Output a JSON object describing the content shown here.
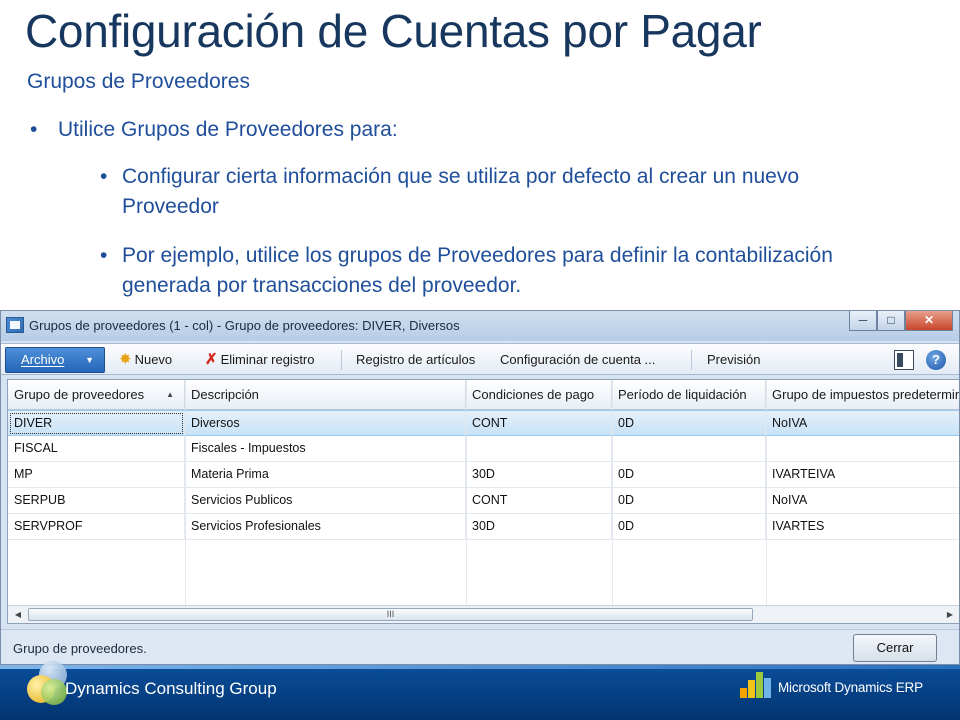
{
  "slide": {
    "title": "Configuración de Cuentas por Pagar",
    "subtitle": "Grupos de Proveedores",
    "bullet_main": "Utilice Grupos de Proveedores para:",
    "bullet_sub_1": "Configurar cierta información que se utiliza por defecto al crear un nuevo Proveedor",
    "bullet_sub_2": "Por ejemplo, utilice los grupos de Proveedores para definir la contabilización generada por transacciones del proveedor.",
    "bullet_glyph": "•"
  },
  "window": {
    "title": "Grupos de proveedores (1 - col) - Grupo de proveedores: DIVER, Diversos",
    "minimize": "─",
    "maximize": "□",
    "close": "✕"
  },
  "toolbar": {
    "archivo": "Archivo",
    "nuevo": "Nuevo",
    "eliminar": "Eliminar registro",
    "registro_articulos": "Registro de artículos",
    "configuracion_cuenta": "Configuración de cuenta ...",
    "prevision": "Previsión",
    "help": "?"
  },
  "grid": {
    "columns": [
      "Grupo de proveedores",
      "Descripción",
      "Condiciones de pago",
      "Período de liquidación",
      "Grupo de impuestos predeterminado"
    ],
    "rows": [
      [
        "DIVER",
        "Diversos",
        "CONT",
        "0D",
        "NoIVA"
      ],
      [
        "FISCAL",
        "Fiscales - Impuestos",
        "",
        "",
        ""
      ],
      [
        "MP",
        "Materia Prima",
        "30D",
        "0D",
        "IVARTEIVA"
      ],
      [
        "SERPUB",
        "Servicios Publicos",
        "CONT",
        "0D",
        "NoIVA"
      ],
      [
        "SERVPROF",
        "Servicios Profesionales",
        "30D",
        "0D",
        "IVARTES"
      ]
    ],
    "selected_row": 0,
    "scroll_grip": "III"
  },
  "status": {
    "text": "Grupo de proveedores.",
    "close_button": "Cerrar"
  },
  "footer": {
    "company": "Dynamics Consulting Group",
    "brand": "Microsoft Dynamics ERP"
  },
  "colors": {
    "title": "#17375E",
    "body_text": "#1F4E9A",
    "selected_row": "#C8E2F7",
    "footer_bg": "#03336F"
  }
}
